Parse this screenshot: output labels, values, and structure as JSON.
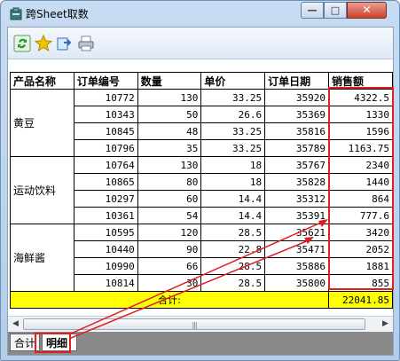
{
  "window": {
    "title": "跨Sheet取数",
    "controls": {
      "minimize": "—",
      "maximize": "□",
      "close": "✕"
    }
  },
  "toolbar": {
    "buttons": [
      {
        "icon": "refresh-icon",
        "color": "#2a9a2a"
      },
      {
        "icon": "star-icon",
        "color": "#f2c200"
      },
      {
        "icon": "export-icon",
        "color": "#2f6fc0"
      },
      {
        "icon": "print-icon",
        "color": "#7a8799"
      }
    ]
  },
  "table": {
    "headers": [
      "产品名称",
      "订单编号",
      "数量",
      "单价",
      "订单日期",
      "销售额"
    ],
    "groups": [
      {
        "category": "黄豆",
        "rows": [
          [
            "10772",
            "130",
            "33.25",
            "35920",
            "4322.5"
          ],
          [
            "10343",
            "50",
            "26.6",
            "35369",
            "1330"
          ],
          [
            "10845",
            "48",
            "33.25",
            "35816",
            "1596"
          ],
          [
            "10796",
            "35",
            "33.25",
            "35789",
            "1163.75"
          ]
        ]
      },
      {
        "category": "运动饮料",
        "rows": [
          [
            "10764",
            "130",
            "18",
            "35767",
            "2340"
          ],
          [
            "10865",
            "80",
            "18",
            "35828",
            "1440"
          ],
          [
            "10297",
            "60",
            "14.4",
            "35312",
            "864"
          ],
          [
            "10361",
            "54",
            "14.4",
            "35391",
            "777.6"
          ]
        ]
      },
      {
        "category": "海鲜酱",
        "rows": [
          [
            "10595",
            "120",
            "28.5",
            "35621",
            "3420"
          ],
          [
            "10440",
            "90",
            "22.8",
            "35471",
            "2052"
          ],
          [
            "10990",
            "66",
            "28.5",
            "35886",
            "1881"
          ],
          [
            "10814",
            "30",
            "28.5",
            "35800",
            "855"
          ]
        ]
      }
    ],
    "total_label": "合计:",
    "total_value": "22041.85"
  },
  "scrollbar": {
    "grip": "|||"
  },
  "tabs": {
    "sum": "合计",
    "detail": "明细"
  },
  "colors": {
    "highlight": "#e02020",
    "total_row": "#ffff00"
  }
}
